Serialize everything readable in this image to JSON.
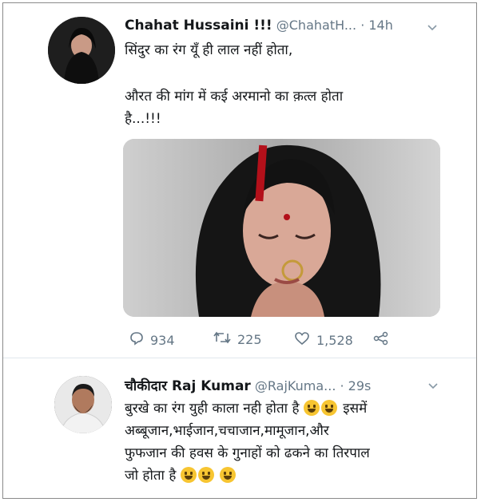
{
  "tweet1": {
    "name": "Chahat Hussaini !!!",
    "handle": "@ChahatH...",
    "time": "· 14h",
    "line1": "सिंदुर का रंग यूँ ही लाल नहीं होता,",
    "line2": "औरत की मांग में कई अरमानो का क़त्ल होता",
    "line3": "है...!!!",
    "replies": "934",
    "retweets": "225",
    "likes": "1,528"
  },
  "tweet2": {
    "name": "चौकीदार Raj Kumar",
    "handle": "@RajKuma...",
    "time": "· 29s",
    "line1": "बुरखे का रंग युही काला नही होता है",
    "line1b": "इसमें",
    "line2": "अब्बूजान,भाईजान,चचाजान,मामूजान,और",
    "line3": "फुफजान की हवस के गुनाहों को ढकने का तिरपाल",
    "line4": "जो होता है"
  },
  "icons": {
    "reply": "reply-icon",
    "retweet": "retweet-icon",
    "like": "heart-icon",
    "share": "share-icon",
    "more": "chevron-down-icon"
  },
  "colors": {
    "muted": "#657786",
    "text": "#14171a"
  }
}
